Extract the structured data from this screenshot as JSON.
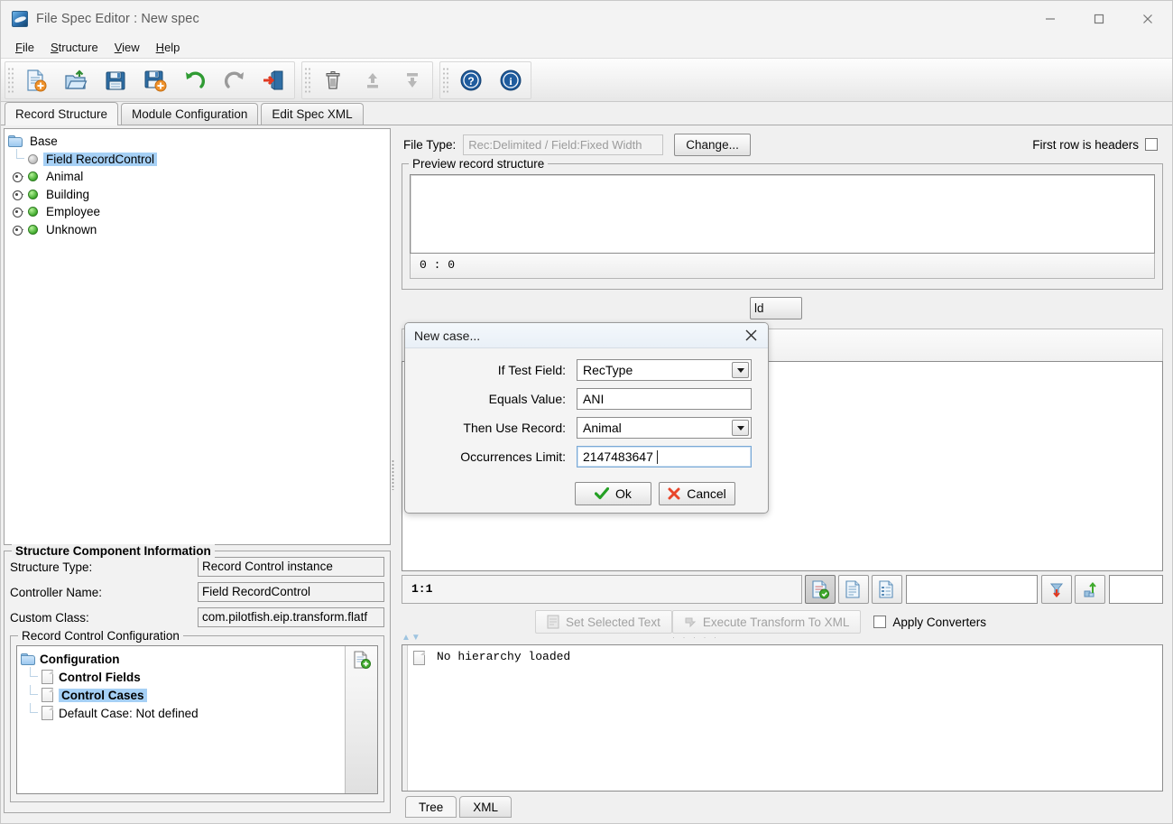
{
  "window": {
    "title": "File Spec Editor : New spec",
    "controls": {
      "minimize": "—",
      "maximize": "□",
      "close": "✕"
    }
  },
  "menu": [
    {
      "label": "File",
      "mnemonic": "F"
    },
    {
      "label": "Structure",
      "mnemonic": "S"
    },
    {
      "label": "View",
      "mnemonic": "V"
    },
    {
      "label": "Help",
      "mnemonic": "H"
    }
  ],
  "toolbar": {
    "groups": [
      {
        "buttons": [
          {
            "name": "new-spec-icon",
            "tooltip": "New"
          },
          {
            "name": "open-spec-icon",
            "tooltip": "Open"
          },
          {
            "name": "save-icon",
            "tooltip": "Save"
          },
          {
            "name": "save-as-icon",
            "tooltip": "Save As"
          },
          {
            "name": "undo-icon",
            "tooltip": "Undo"
          },
          {
            "name": "redo-icon",
            "tooltip": "Redo"
          },
          {
            "name": "exit-icon",
            "tooltip": "Exit"
          }
        ]
      },
      {
        "buttons": [
          {
            "name": "delete-icon",
            "tooltip": "Delete"
          },
          {
            "name": "move-up-icon",
            "tooltip": "Move Up"
          },
          {
            "name": "move-down-icon",
            "tooltip": "Move Down"
          }
        ]
      },
      {
        "buttons": [
          {
            "name": "help-icon",
            "tooltip": "Help"
          },
          {
            "name": "about-icon",
            "tooltip": "About"
          }
        ]
      }
    ]
  },
  "tabs": {
    "items": [
      {
        "label": "Record Structure",
        "selected": true
      },
      {
        "label": "Module Configuration",
        "selected": false
      },
      {
        "label": "Edit Spec XML",
        "selected": false
      }
    ]
  },
  "structure_tree": {
    "nodes": [
      {
        "label": "Base",
        "icon": "folder",
        "indent": 0,
        "expander": false,
        "selected": false
      },
      {
        "label": "Field RecordControl",
        "icon": "gray-ball",
        "indent": 1,
        "expander": false,
        "selected": true
      },
      {
        "label": "Animal",
        "icon": "green-ball",
        "indent": 0,
        "expander": true,
        "selected": false
      },
      {
        "label": "Building",
        "icon": "green-ball",
        "indent": 0,
        "expander": true,
        "selected": false
      },
      {
        "label": "Employee",
        "icon": "green-ball",
        "indent": 0,
        "expander": true,
        "selected": false
      },
      {
        "label": "Unknown",
        "icon": "green-ball",
        "indent": 0,
        "expander": true,
        "selected": false
      }
    ]
  },
  "structure_info": {
    "legend": "Structure Component Information",
    "rows": [
      {
        "label": "Structure Type:",
        "value": "Record Control instance"
      },
      {
        "label": "Controller Name:",
        "value": "Field RecordControl"
      },
      {
        "label": "Custom Class:",
        "value": "com.pilotfish.eip.transform.flatf"
      }
    ],
    "record_control_configuration": {
      "legend": "Record Control Configuration",
      "nodes": [
        {
          "label": "Configuration",
          "icon": "folder",
          "indent": 0,
          "selected": false
        },
        {
          "label": "Control Fields",
          "icon": "doc",
          "indent": 1,
          "selected": false
        },
        {
          "label": "Control Cases",
          "icon": "doc",
          "indent": 1,
          "selected": true
        },
        {
          "label": "Default Case: Not defined",
          "icon": "doc",
          "indent": 1,
          "selected": false
        }
      ],
      "side_button": {
        "name": "add-case-icon",
        "label": ""
      }
    }
  },
  "file_type": {
    "label": "File Type:",
    "value": "Rec:Delimited / Field:Fixed Width",
    "change_button": "Change...",
    "first_row_headers_label": "First row is headers",
    "first_row_headers_checked": false
  },
  "preview": {
    "legend": "Preview record structure",
    "content": "",
    "status": "0 : 0"
  },
  "hidden_button": {
    "partial_label": "ld"
  },
  "editor": {
    "position": "1:1",
    "buttons": [
      {
        "name": "validate-doc-icon",
        "pressed": true
      },
      {
        "name": "plain-doc-icon",
        "pressed": false
      },
      {
        "name": "structured-doc-icon",
        "pressed": false
      }
    ],
    "field_value": "",
    "down-button": {
      "name": "import-down-icon"
    },
    "up-button": {
      "name": "export-up-icon"
    },
    "trailing_field_value": ""
  },
  "actions": {
    "set_selected_text": "Set Selected Text",
    "execute_transform": "Execute Transform To XML",
    "apply_converters_label": "Apply Converters",
    "apply_converters_checked": false
  },
  "hierarchy": {
    "message": "No hierarchy loaded"
  },
  "bottom_tabs": {
    "items": [
      {
        "label": "Tree",
        "selected": true
      },
      {
        "label": "XML",
        "selected": false
      }
    ]
  },
  "dialog": {
    "title": "New case...",
    "close_label": "✕",
    "fields": [
      {
        "label": "If Test Field:",
        "value": "RecType",
        "type": "combo",
        "focused": false
      },
      {
        "label": "Equals Value:",
        "value": "ANI",
        "type": "text",
        "focused": false
      },
      {
        "label": "Then Use Record:",
        "value": "Animal",
        "type": "combo",
        "focused": false
      },
      {
        "label": "Occurrences Limit:",
        "value": "2147483647",
        "type": "text",
        "focused": true
      }
    ],
    "ok_label": "Ok",
    "cancel_label": "Cancel"
  },
  "colors": {
    "selection": "#a6d0f5",
    "window_bg": "#f0f0f0",
    "accent_green": "#3faa2c",
    "accent_red": "#e03a22",
    "accent_blue": "#1f5c9e"
  }
}
